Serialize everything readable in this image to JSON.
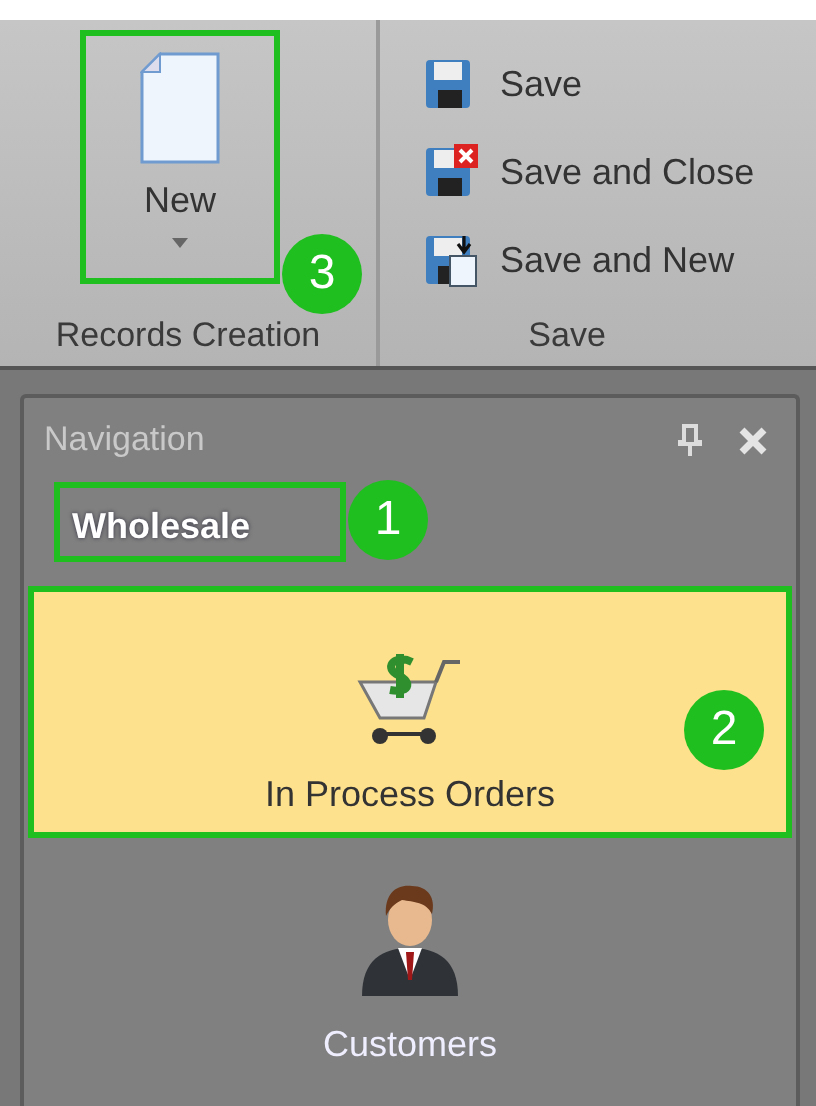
{
  "ribbon": {
    "groups": [
      {
        "caption": "Records Creation",
        "buttons": [
          {
            "label": "New",
            "kind": "large",
            "dropdown": true,
            "callout": "3"
          }
        ]
      },
      {
        "caption": "Save",
        "buttons": [
          {
            "label": "Save",
            "kind": "small"
          },
          {
            "label": "Save and Close",
            "kind": "small"
          },
          {
            "label": "Save and New",
            "kind": "small"
          }
        ]
      }
    ]
  },
  "navigation": {
    "title": "Navigation",
    "group": {
      "label": "Wholesale",
      "callout": "1"
    },
    "items": [
      {
        "label": "In Process Orders",
        "selected": true,
        "callout": "2"
      },
      {
        "label": "Customers",
        "selected": false
      }
    ]
  }
}
